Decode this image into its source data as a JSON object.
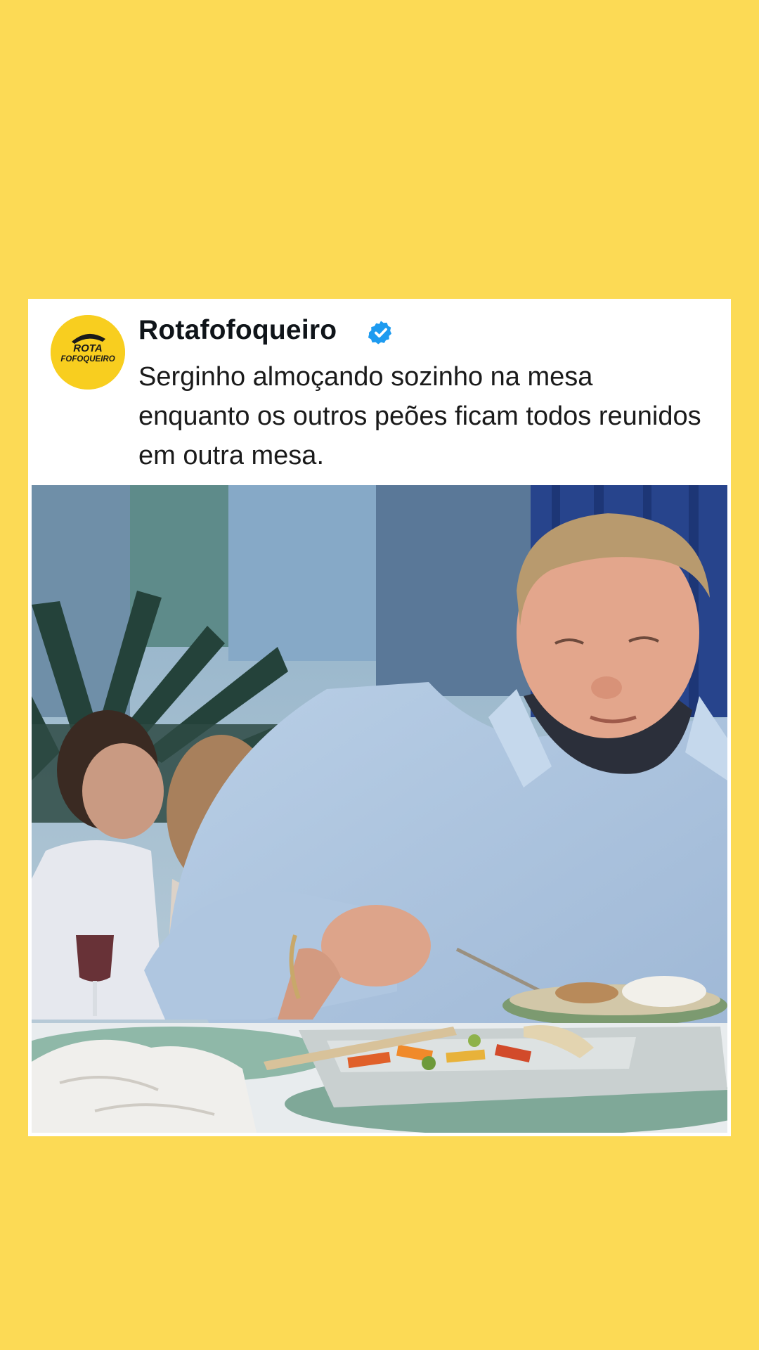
{
  "post": {
    "account_name": "Rotafofoqueiro",
    "verified_icon": "verified-badge-icon",
    "avatar_text_line1": "ROTA",
    "avatar_text_line2": "FOFOQUEIRO",
    "text": "Serginho almoçando sozinho na mesa enquanto os outros peões ficam todos reunidos em outra mesa.",
    "media_icon": "video-frame-image"
  },
  "colors": {
    "background": "#FCDA55",
    "card": "#FFFFFF",
    "avatar": "#F8CE1F",
    "verified": "#1D9BF0",
    "text": "#0F1419"
  }
}
